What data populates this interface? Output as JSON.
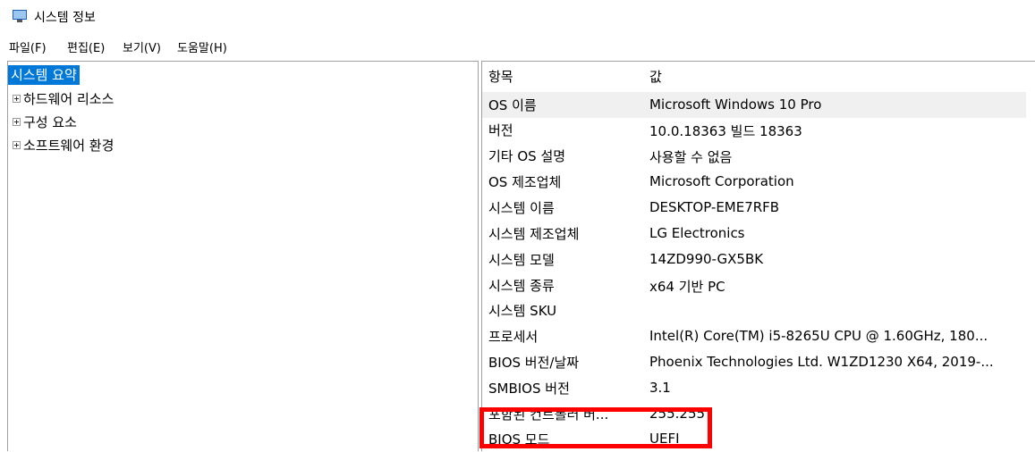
{
  "window": {
    "title": "시스템 정보"
  },
  "menu": [
    {
      "label": "파일(F)"
    },
    {
      "label": "편집(E)"
    },
    {
      "label": "보기(V)"
    },
    {
      "label": "도움말(H)"
    }
  ],
  "tree": [
    {
      "label": "시스템 요약",
      "selected": true,
      "expandable": false
    },
    {
      "label": "하드웨어 리소스",
      "selected": false,
      "expandable": true
    },
    {
      "label": "구성 요소",
      "selected": false,
      "expandable": true
    },
    {
      "label": "소프트웨어 환경",
      "selected": false,
      "expandable": true
    }
  ],
  "table": {
    "headers": {
      "key": "항목",
      "value": "값"
    },
    "rows": [
      {
        "key": "OS 이름",
        "value": "Microsoft Windows 10 Pro"
      },
      {
        "key": "버전",
        "value": "10.0.18363 빌드 18363"
      },
      {
        "key": "기타 OS 설명",
        "value": "사용할 수 없음"
      },
      {
        "key": "OS 제조업체",
        "value": "Microsoft Corporation"
      },
      {
        "key": "시스템 이름",
        "value": "DESKTOP-EME7RFB"
      },
      {
        "key": "시스템 제조업체",
        "value": "LG Electronics"
      },
      {
        "key": "시스템 모델",
        "value": "14ZD990-GX5BK"
      },
      {
        "key": "시스템 종류",
        "value": "x64 기반 PC"
      },
      {
        "key": "시스템 SKU",
        "value": ""
      },
      {
        "key": "프로세서",
        "value": "Intel(R) Core(TM) i5-8265U CPU @ 1.60GHz, 180..."
      },
      {
        "key": "BIOS 버전/날짜",
        "value": "Phoenix Technologies Ltd. W1ZD1230 X64, 2019-..."
      },
      {
        "key": "SMBIOS 버전",
        "value": "3.1"
      },
      {
        "key": "포함된 컨트롤러 버...",
        "value": "255.255"
      },
      {
        "key": "BIOS 모드",
        "value": "UEFI"
      }
    ]
  },
  "colors": {
    "selection": "#0078d7",
    "highlight_box": "#ff0000",
    "row_highlight": "#f0f0f0"
  }
}
